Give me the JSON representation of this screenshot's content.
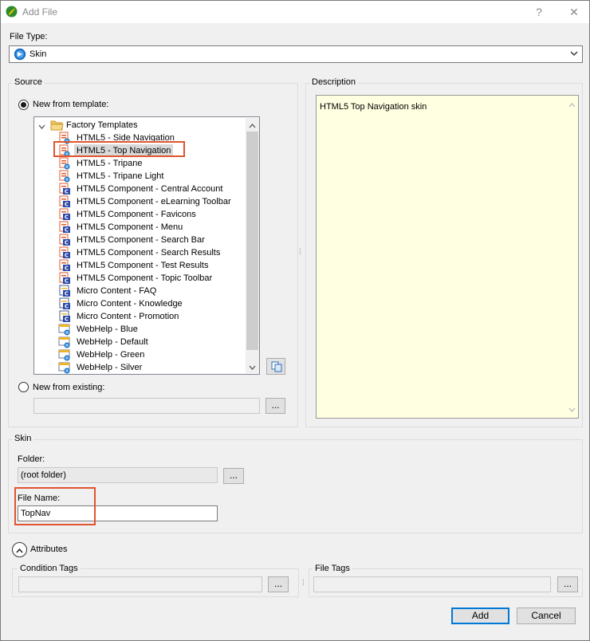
{
  "window": {
    "title": "Add File",
    "help_label": "?",
    "close_label": "✕"
  },
  "file_type": {
    "label": "File Type:",
    "value": "Skin",
    "icon": "skin-globe-icon"
  },
  "source": {
    "group_label": "Source",
    "new_from_template_label": "New from template:",
    "new_from_existing_label": "New from existing:",
    "existing_browse_label": "...",
    "copy_button_icon": "copy-icon",
    "tree": {
      "root": "Factory Templates",
      "items": [
        {
          "label": "HTML5 - Side Navigation",
          "icon": "html5-skin-icon"
        },
        {
          "label": "HTML5 - Top Navigation",
          "icon": "html5-skin-icon"
        },
        {
          "label": "HTML5 - Tripane",
          "icon": "html5-skin-icon"
        },
        {
          "label": "HTML5 - Tripane Light",
          "icon": "html5-skin-icon"
        },
        {
          "label": "HTML5 Component - Central Account",
          "icon": "html5-component-icon"
        },
        {
          "label": "HTML5 Component - eLearning Toolbar",
          "icon": "html5-component-icon"
        },
        {
          "label": "HTML5 Component - Favicons",
          "icon": "html5-component-icon"
        },
        {
          "label": "HTML5 Component - Menu",
          "icon": "html5-component-icon"
        },
        {
          "label": "HTML5 Component - Search Bar",
          "icon": "html5-component-icon"
        },
        {
          "label": "HTML5 Component - Search Results",
          "icon": "html5-component-icon"
        },
        {
          "label": "HTML5 Component - Test Results",
          "icon": "html5-component-icon"
        },
        {
          "label": "HTML5 Component - Topic Toolbar",
          "icon": "html5-component-icon"
        },
        {
          "label": "Micro Content - FAQ",
          "icon": "micro-content-icon"
        },
        {
          "label": "Micro Content - Knowledge",
          "icon": "micro-content-icon"
        },
        {
          "label": "Micro Content - Promotion",
          "icon": "micro-content-icon"
        },
        {
          "label": "WebHelp - Blue",
          "icon": "webhelp-icon"
        },
        {
          "label": "WebHelp - Default",
          "icon": "webhelp-icon"
        },
        {
          "label": "WebHelp - Green",
          "icon": "webhelp-icon"
        },
        {
          "label": "WebHelp - Silver",
          "icon": "webhelp-icon"
        }
      ]
    }
  },
  "description": {
    "group_label": "Description",
    "text": "HTML5 Top Navigation skin"
  },
  "skin": {
    "group_label": "Skin",
    "folder_label": "Folder:",
    "folder_value": "(root folder)",
    "folder_browse_label": "...",
    "file_name_label": "File Name:",
    "file_name_value": "TopNav"
  },
  "attributes": {
    "toggle_label": "Attributes",
    "condition_tags_label": "Condition Tags",
    "condition_browse_label": "...",
    "file_tags_label": "File Tags",
    "file_tags_browse_label": "..."
  },
  "footer": {
    "add_label": "Add",
    "cancel_label": "Cancel"
  },
  "colors": {
    "highlight": "#e0542f",
    "description_bg": "#ffffe1",
    "primary_border": "#0078d7"
  }
}
